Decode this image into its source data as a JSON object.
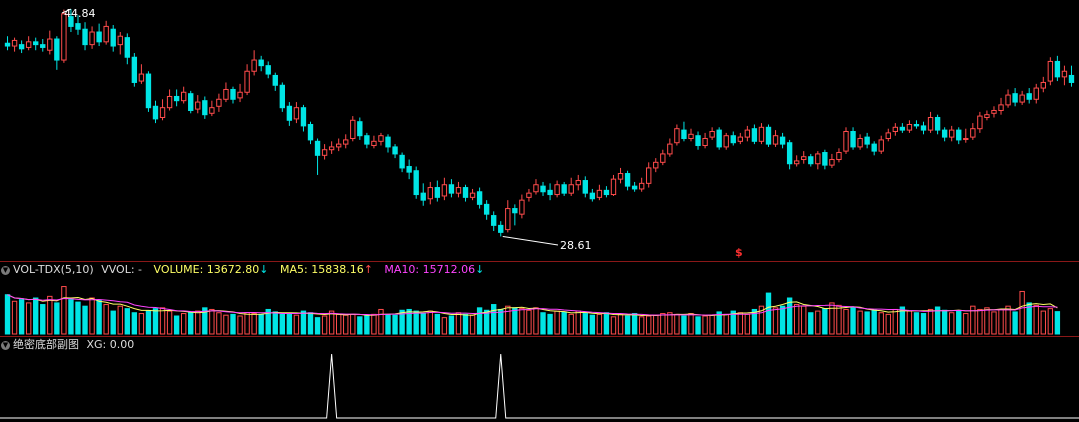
{
  "colors": {
    "up": "#ff4c4c",
    "down": "#00e5e5",
    "ma5": "#ffff66",
    "ma10": "#ff44ff",
    "text": "#cccccc",
    "xg": "#ffffff",
    "separator": "#8a1818"
  },
  "icons": {
    "collapse": "chevron-down-icon",
    "marker": "dollar-icon"
  },
  "price_panel": {
    "max_label": "44.84",
    "min_label": "28.61",
    "marker_symbol": "$"
  },
  "volume_panel": {
    "indicator_name": "VOL-TDX(5,10)",
    "vvol_label": "VVOL: -",
    "volume_label": "VOLUME: 13672.80",
    "volume_arrow": "↓",
    "ma5_label": "MA5: 15838.16",
    "ma5_arrow": "↑",
    "ma10_label": "MA10: 15712.06",
    "ma10_arrow": "↓"
  },
  "signal_panel": {
    "indicator_name": "绝密底部副图",
    "xg_label": "XG: 0.00"
  },
  "chart_data": {
    "type": "candlestick",
    "price_range": [
      27.5,
      45.2
    ],
    "price_high_marked": 44.84,
    "price_low_marked": 28.61,
    "candles": [
      [
        42.4,
        42.2,
        42.9,
        41.9
      ],
      [
        42.2,
        42.6,
        42.8,
        41.8
      ],
      [
        42.3,
        42.0,
        42.6,
        41.7
      ],
      [
        42.1,
        42.5,
        42.9,
        41.9
      ],
      [
        42.5,
        42.3,
        42.8,
        41.9
      ],
      [
        42.3,
        42.1,
        42.7,
        41.8
      ],
      [
        41.9,
        42.7,
        43.3,
        41.6
      ],
      [
        42.7,
        41.2,
        42.9,
        40.5
      ],
      [
        41.2,
        44.5,
        44.8,
        41.0
      ],
      [
        44.3,
        43.6,
        44.84,
        43.2
      ],
      [
        43.8,
        43.4,
        44.4,
        43.0
      ],
      [
        43.4,
        42.3,
        43.9,
        41.9
      ],
      [
        42.3,
        43.2,
        43.6,
        42.0
      ],
      [
        43.2,
        42.5,
        43.8,
        42.2
      ],
      [
        42.5,
        43.6,
        44.0,
        42.3
      ],
      [
        43.4,
        42.2,
        43.7,
        41.8
      ],
      [
        42.3,
        42.9,
        43.2,
        41.6
      ],
      [
        42.8,
        41.4,
        43.1,
        40.9
      ],
      [
        41.4,
        39.6,
        41.7,
        39.3
      ],
      [
        39.7,
        40.2,
        40.9,
        39.5
      ],
      [
        40.2,
        37.8,
        40.4,
        37.5
      ],
      [
        37.9,
        37.0,
        38.3,
        36.7
      ],
      [
        37.1,
        37.8,
        38.4,
        36.9
      ],
      [
        37.8,
        38.6,
        39.1,
        37.6
      ],
      [
        38.6,
        38.3,
        39.1,
        37.9
      ],
      [
        38.3,
        38.9,
        39.3,
        38.1
      ],
      [
        38.8,
        37.6,
        39.0,
        37.4
      ],
      [
        37.7,
        38.2,
        38.7,
        37.4
      ],
      [
        38.3,
        37.3,
        38.6,
        37.0
      ],
      [
        37.4,
        37.8,
        38.3,
        37.2
      ],
      [
        37.9,
        38.4,
        38.8,
        37.5
      ],
      [
        38.4,
        39.1,
        39.6,
        38.2
      ],
      [
        39.1,
        38.4,
        39.3,
        38.1
      ],
      [
        38.5,
        38.9,
        39.5,
        38.2
      ],
      [
        38.9,
        40.4,
        40.9,
        38.7
      ],
      [
        40.4,
        41.2,
        41.9,
        40.1
      ],
      [
        41.2,
        40.8,
        41.5,
        40.4
      ],
      [
        40.8,
        40.2,
        41.1,
        39.9
      ],
      [
        40.1,
        39.4,
        40.3,
        39.0
      ],
      [
        39.4,
        37.8,
        39.6,
        37.5
      ],
      [
        37.9,
        36.9,
        38.2,
        36.5
      ],
      [
        37.0,
        37.8,
        38.2,
        36.7
      ],
      [
        37.8,
        36.5,
        38.0,
        36.1
      ],
      [
        36.6,
        35.5,
        36.8,
        35.2
      ],
      [
        35.4,
        34.4,
        35.6,
        33.0
      ],
      [
        34.4,
        34.8,
        35.2,
        34.1
      ],
      [
        34.8,
        35.0,
        35.4,
        34.5
      ],
      [
        35.0,
        35.2,
        35.6,
        34.7
      ],
      [
        35.2,
        35.5,
        35.9,
        34.9
      ],
      [
        35.6,
        36.9,
        37.2,
        35.4
      ],
      [
        36.8,
        35.8,
        37.1,
        35.5
      ],
      [
        35.8,
        35.2,
        36.0,
        34.9
      ],
      [
        35.1,
        35.4,
        35.8,
        34.9
      ],
      [
        35.4,
        35.8,
        36.0,
        35.1
      ],
      [
        35.7,
        35.0,
        35.9,
        34.6
      ],
      [
        35.0,
        34.5,
        35.2,
        34.2
      ],
      [
        34.4,
        33.5,
        34.6,
        33.2
      ],
      [
        33.6,
        33.2,
        34.1,
        32.7
      ],
      [
        33.3,
        31.6,
        33.6,
        31.3
      ],
      [
        31.7,
        31.2,
        32.4,
        30.8
      ],
      [
        31.3,
        32.1,
        32.5,
        30.9
      ],
      [
        32.1,
        31.4,
        32.6,
        31.1
      ],
      [
        31.5,
        32.3,
        32.8,
        31.2
      ],
      [
        32.3,
        31.7,
        32.7,
        31.4
      ],
      [
        31.7,
        32.1,
        32.5,
        31.4
      ],
      [
        32.1,
        31.4,
        32.3,
        31.1
      ],
      [
        31.4,
        31.7,
        32.0,
        31.2
      ],
      [
        31.8,
        30.9,
        32.1,
        30.6
      ],
      [
        30.9,
        30.2,
        31.2,
        29.8
      ],
      [
        30.1,
        29.4,
        30.4,
        29.0
      ],
      [
        29.4,
        28.9,
        29.7,
        28.61
      ],
      [
        29.1,
        30.6,
        31.2,
        28.9
      ],
      [
        30.6,
        30.3,
        30.9,
        29.4
      ],
      [
        30.2,
        31.2,
        31.6,
        29.9
      ],
      [
        31.4,
        31.7,
        32.0,
        31.1
      ],
      [
        31.8,
        32.3,
        32.7,
        31.6
      ],
      [
        32.2,
        31.8,
        32.5,
        31.5
      ],
      [
        31.9,
        31.6,
        32.4,
        31.2
      ],
      [
        31.6,
        32.3,
        32.6,
        31.4
      ],
      [
        32.3,
        31.7,
        32.5,
        31.5
      ],
      [
        31.7,
        32.3,
        32.8,
        31.5
      ],
      [
        32.3,
        32.6,
        33.0,
        31.9
      ],
      [
        32.6,
        31.7,
        32.9,
        31.4
      ],
      [
        31.7,
        31.3,
        32.0,
        31.1
      ],
      [
        31.4,
        31.9,
        32.3,
        31.2
      ],
      [
        31.9,
        31.6,
        32.2,
        31.4
      ],
      [
        31.6,
        32.7,
        33.0,
        31.5
      ],
      [
        32.7,
        33.1,
        33.5,
        32.4
      ],
      [
        33.1,
        32.2,
        33.3,
        31.9
      ],
      [
        32.2,
        32.0,
        32.5,
        31.8
      ],
      [
        32.0,
        32.4,
        32.8,
        31.8
      ],
      [
        32.4,
        33.5,
        33.9,
        32.1
      ],
      [
        33.5,
        33.9,
        34.2,
        33.2
      ],
      [
        33.9,
        34.5,
        34.8,
        33.7
      ],
      [
        34.5,
        35.2,
        35.6,
        34.3
      ],
      [
        35.3,
        36.3,
        36.6,
        35.1
      ],
      [
        36.2,
        35.6,
        36.8,
        35.4
      ],
      [
        35.6,
        35.9,
        36.3,
        35.4
      ],
      [
        35.8,
        35.1,
        36.1,
        34.8
      ],
      [
        35.1,
        35.6,
        36.0,
        34.9
      ],
      [
        35.7,
        36.1,
        36.4,
        35.5
      ],
      [
        36.2,
        35.0,
        36.4,
        34.8
      ],
      [
        35.0,
        35.8,
        36.0,
        34.8
      ],
      [
        35.8,
        35.3,
        36.1,
        35.1
      ],
      [
        35.4,
        35.7,
        36.0,
        35.2
      ],
      [
        35.7,
        36.2,
        36.5,
        35.4
      ],
      [
        36.3,
        35.4,
        36.6,
        35.2
      ],
      [
        35.4,
        36.4,
        36.7,
        35.2
      ],
      [
        36.4,
        35.2,
        36.6,
        35.0
      ],
      [
        35.2,
        35.8,
        36.2,
        35.0
      ],
      [
        35.7,
        35.2,
        36.0,
        34.9
      ],
      [
        35.3,
        33.8,
        35.5,
        33.4
      ],
      [
        33.8,
        34.0,
        34.4,
        33.6
      ],
      [
        34.1,
        34.3,
        34.7,
        33.8
      ],
      [
        34.3,
        33.8,
        34.5,
        33.6
      ],
      [
        33.8,
        34.5,
        34.7,
        33.4
      ],
      [
        34.6,
        33.7,
        34.8,
        33.4
      ],
      [
        33.7,
        34.1,
        34.5,
        33.5
      ],
      [
        34.1,
        34.6,
        34.9,
        33.9
      ],
      [
        34.7,
        36.1,
        36.4,
        34.5
      ],
      [
        36.1,
        35.0,
        36.4,
        34.8
      ],
      [
        35.0,
        35.6,
        35.9,
        34.8
      ],
      [
        35.7,
        35.2,
        36.0,
        34.9
      ],
      [
        35.2,
        34.7,
        35.4,
        34.4
      ],
      [
        34.7,
        35.5,
        35.8,
        34.5
      ],
      [
        35.6,
        36.0,
        36.3,
        35.4
      ],
      [
        36.1,
        36.4,
        36.7,
        35.8
      ],
      [
        36.4,
        36.2,
        36.7,
        36.0
      ],
      [
        36.2,
        36.6,
        36.9,
        36.0
      ],
      [
        36.6,
        36.5,
        36.9,
        36.3
      ],
      [
        36.5,
        36.2,
        36.8,
        35.9
      ],
      [
        36.2,
        37.1,
        37.5,
        36.0
      ],
      [
        37.1,
        36.2,
        37.3,
        35.9
      ],
      [
        36.2,
        35.7,
        36.4,
        35.4
      ],
      [
        35.7,
        36.2,
        36.5,
        35.4
      ],
      [
        36.2,
        35.5,
        36.4,
        35.2
      ],
      [
        35.6,
        35.6,
        36.3,
        35.3
      ],
      [
        35.7,
        36.3,
        36.7,
        35.5
      ],
      [
        36.3,
        37.2,
        37.5,
        36.0
      ],
      [
        37.1,
        37.3,
        37.6,
        36.9
      ],
      [
        37.4,
        37.6,
        37.9,
        37.1
      ],
      [
        37.6,
        38.0,
        38.5,
        37.3
      ],
      [
        38.0,
        38.7,
        39.1,
        37.8
      ],
      [
        38.8,
        38.2,
        39.2,
        37.9
      ],
      [
        38.2,
        38.7,
        39.0,
        38.0
      ],
      [
        38.8,
        38.4,
        39.2,
        38.1
      ],
      [
        38.4,
        39.2,
        39.5,
        38.1
      ],
      [
        39.2,
        39.6,
        40.0,
        38.9
      ],
      [
        39.7,
        41.1,
        41.4,
        39.4
      ],
      [
        41.1,
        40.0,
        41.5,
        39.7
      ],
      [
        40.0,
        40.4,
        40.8,
        39.4
      ],
      [
        40.1,
        39.6,
        40.8,
        39.3
      ]
    ],
    "volume": {
      "ylim": [
        0,
        33000
      ],
      "values": [
        24000,
        20000,
        21000,
        19000,
        22000,
        18000,
        23000,
        19000,
        29000,
        21000,
        19500,
        17000,
        22000,
        20500,
        18000,
        14000,
        17000,
        15500,
        13000,
        12500,
        14000,
        15500,
        16000,
        14000,
        11000,
        12500,
        13500,
        14000,
        16000,
        15000,
        13000,
        11500,
        12000,
        11000,
        13000,
        12500,
        12000,
        15000,
        13500,
        12000,
        12500,
        11500,
        14000,
        13000,
        10000,
        11000,
        14000,
        12000,
        11500,
        12000,
        10500,
        11000,
        12000,
        15000,
        12000,
        11500,
        14500,
        15000,
        14000,
        12500,
        14000,
        12000,
        10000,
        11000,
        13000,
        12000,
        11500,
        16000,
        14500,
        18000,
        15000,
        17000,
        16000,
        15500,
        14500,
        16000,
        13000,
        12000,
        14000,
        13500,
        12000,
        14000,
        12500,
        11500,
        12000,
        13000,
        10500,
        12000,
        11000,
        12500,
        10500,
        11000,
        11500,
        12500,
        13000,
        12000,
        11000,
        12500,
        10500,
        11000,
        11500,
        13500,
        12000,
        14000,
        13000,
        12000,
        15000,
        17000,
        25000,
        16000,
        17000,
        22000,
        18000,
        17000,
        13000,
        14000,
        15500,
        19000,
        17500,
        15000,
        16000,
        14000,
        13500,
        14500,
        13000,
        12000,
        15000,
        16500,
        14000,
        13000,
        12500,
        15000,
        16500,
        14500,
        13000,
        14000,
        12500,
        17000,
        15000,
        16000,
        13500,
        15000,
        17000,
        13500,
        26000,
        19000,
        17500,
        14000,
        15500,
        13672.8
      ],
      "ma5_latest": 15838.16,
      "ma10_latest": 15712.06
    },
    "xg_signal": {
      "ylim": [
        0,
        1
      ],
      "spikes_at_candle_index": [
        46,
        70
      ]
    }
  }
}
